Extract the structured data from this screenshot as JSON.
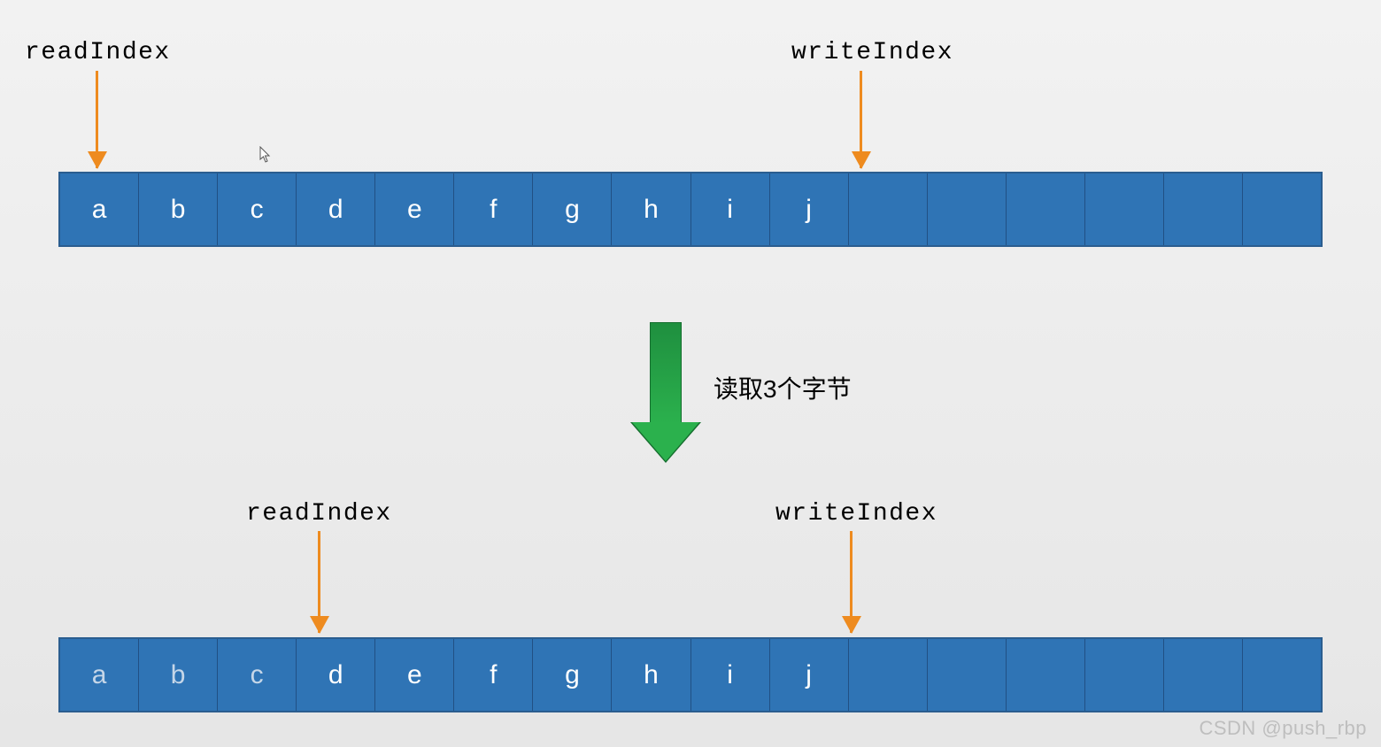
{
  "labels": {
    "readIndex": "readIndex",
    "writeIndex": "writeIndex",
    "transition": "读取3个字节"
  },
  "buffer1": {
    "cells": [
      "a",
      "b",
      "c",
      "d",
      "e",
      "f",
      "g",
      "h",
      "i",
      "j",
      "",
      "",
      "",
      "",
      "",
      ""
    ],
    "readIndexCell": 0,
    "writeIndexCell": 10
  },
  "buffer2": {
    "cells": [
      "a",
      "b",
      "c",
      "d",
      "e",
      "f",
      "g",
      "h",
      "i",
      "j",
      "",
      "",
      "",
      "",
      "",
      ""
    ],
    "dimCells": [
      0,
      1,
      2
    ],
    "readIndexCell": 3,
    "writeIndexCell": 10
  },
  "watermark": "CSDN @push_rbp"
}
